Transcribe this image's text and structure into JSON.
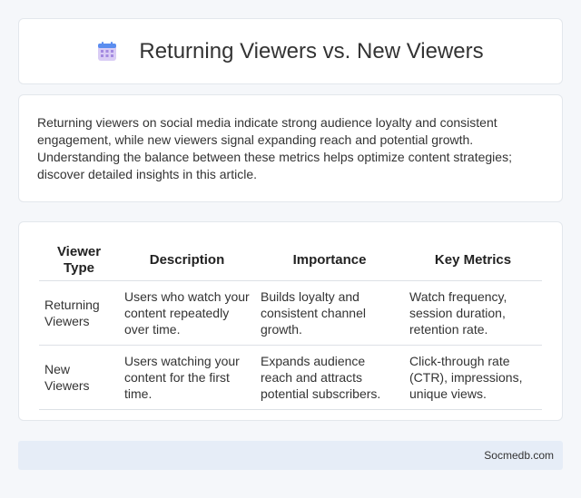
{
  "header": {
    "title": "Returning Viewers vs. New Viewers",
    "icon": "calendar-icon"
  },
  "intro": {
    "text": "Returning viewers on social media indicate strong audience loyalty and consistent engagement, while new viewers signal expanding reach and potential growth. Understanding the balance between these metrics helps optimize content strategies; discover detailed insights in this article."
  },
  "table": {
    "headers": [
      "Viewer Type",
      "Description",
      "Importance",
      "Key Metrics"
    ],
    "rows": [
      [
        "Returning Viewers",
        "Users who watch your content repeatedly over time.",
        "Builds loyalty and consistent channel growth.",
        "Watch frequency, session duration, retention rate."
      ],
      [
        "New Viewers",
        "Users watching your content for the first time.",
        "Expands audience reach and attracts potential subscribers.",
        "Click-through rate (CTR), impressions, unique views."
      ]
    ]
  },
  "footer": {
    "text": "Socmedb.com"
  },
  "colors": {
    "icon_top": "#5b8def",
    "icon_body": "#c9b8f0"
  }
}
